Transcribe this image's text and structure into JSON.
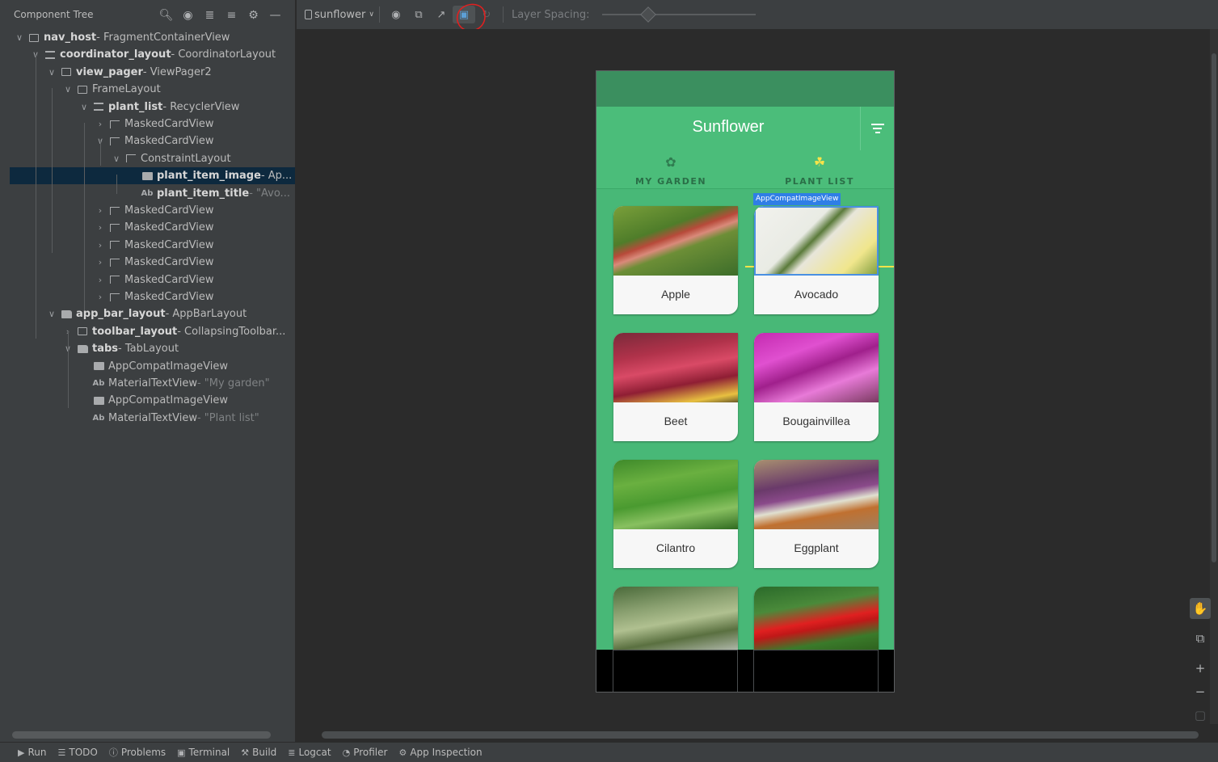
{
  "component_tree": {
    "title": "Component Tree",
    "toolbar_icons": [
      "search-icon",
      "eye-icon",
      "expand-all-icon",
      "collapse-all-icon",
      "gear-icon",
      "minimize-icon"
    ],
    "rows": [
      {
        "name": "nav_host",
        "type": "FragmentContainerView"
      },
      {
        "name": "coordinator_layout",
        "type": "CoordinatorLayout"
      },
      {
        "name": "view_pager",
        "type": "ViewPager2"
      },
      {
        "name": "",
        "type": "FrameLayout"
      },
      {
        "name": "plant_list",
        "type": "RecyclerView"
      },
      {
        "name": "",
        "type": "MaskedCardView"
      },
      {
        "name": "",
        "type": "MaskedCardView"
      },
      {
        "name": "",
        "type": "ConstraintLayout"
      },
      {
        "name": "plant_item_image",
        "type": "Ap..."
      },
      {
        "name": "plant_item_title",
        "type": "\"Avo..."
      },
      {
        "name": "",
        "type": "MaskedCardView"
      },
      {
        "name": "",
        "type": "MaskedCardView"
      },
      {
        "name": "",
        "type": "MaskedCardView"
      },
      {
        "name": "",
        "type": "MaskedCardView"
      },
      {
        "name": "",
        "type": "MaskedCardView"
      },
      {
        "name": "",
        "type": "MaskedCardView"
      },
      {
        "name": "app_bar_layout",
        "type": "AppBarLayout"
      },
      {
        "name": "toolbar_layout",
        "type": "CollapsingToolbar..."
      },
      {
        "name": "tabs",
        "type": "TabLayout"
      },
      {
        "name": "",
        "type": "AppCompatImageView"
      },
      {
        "name": "",
        "type": "MaterialTextView",
        "value": "\"My garden\""
      },
      {
        "name": "",
        "type": "AppCompatImageView"
      },
      {
        "name": "",
        "type": "MaterialTextView",
        "value": "\"Plant list\""
      }
    ],
    "separator": " - ",
    "text_prefix": "Ab"
  },
  "toolbar": {
    "device": "sunflower",
    "layer_spacing_label": "Layer Spacing:",
    "layer_spacing_value": 0.3
  },
  "app": {
    "title": "Sunflower",
    "tabs": [
      "MY GARDEN",
      "PLANT LIST"
    ],
    "selected_tab": 1,
    "plants": [
      "Apple",
      "Avocado",
      "Beet",
      "Bougainvillea",
      "Cilantro",
      "Eggplant",
      "",
      ""
    ],
    "selection_label": "AppCompatImageView"
  },
  "bottom_bar": [
    "Run",
    "TODO",
    "Problems",
    "Terminal",
    "Build",
    "Logcat",
    "Profiler",
    "App Inspection"
  ],
  "colors": {
    "accent_green": "#4bbd7a",
    "status_green": "#3b8f5f",
    "tab_indicator": "#f7e34a",
    "selection_blue": "#2f7ee6"
  }
}
